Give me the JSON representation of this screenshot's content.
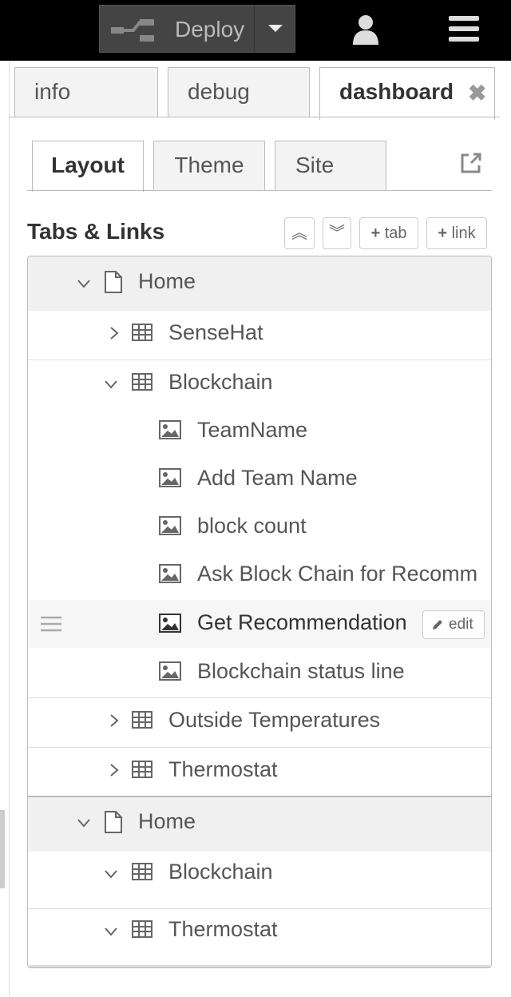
{
  "header": {
    "deploy_label": "Deploy"
  },
  "sidebar_tabs": [
    {
      "label": "info"
    },
    {
      "label": "debug"
    },
    {
      "label": "dashboard"
    }
  ],
  "close_glyph": "✖",
  "inner_tabs": [
    {
      "label": "Layout"
    },
    {
      "label": "Theme"
    },
    {
      "label": "Site"
    }
  ],
  "section": {
    "title": "Tabs & Links",
    "buttons": {
      "collapse_all": "︽",
      "expand_all": "︾",
      "add_tab": "tab",
      "add_link": "link",
      "plus": "+"
    }
  },
  "tree": {
    "tab1": {
      "label": "Home",
      "groups": {
        "sensehat": "SenseHat",
        "blockchain": {
          "label": "Blockchain",
          "widgets": [
            "TeamName",
            "Add Team Name",
            "block count",
            "Ask Block Chain for Recomm",
            "Get Recommendation",
            "Blockchain status line"
          ]
        },
        "outside_temps": "Outside Temperatures",
        "thermostat": "Thermostat"
      }
    },
    "tab2": {
      "label": "Home",
      "groups": {
        "blockchain": "Blockchain",
        "thermostat": "Thermostat"
      }
    },
    "edit_label": "edit"
  },
  "colors": {
    "header_bg": "#000000",
    "deploy_bg": "#444444",
    "tab_row_bg": "#f0f0f0",
    "border": "#bbbbbb"
  }
}
